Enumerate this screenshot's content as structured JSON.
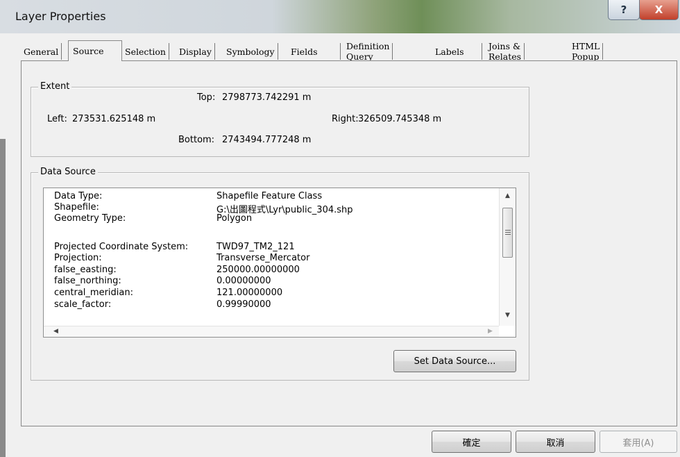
{
  "window": {
    "title": "Layer Properties",
    "help_glyph": "?",
    "close_glyph": "X"
  },
  "tabs": [
    "General",
    "Source",
    "Selection",
    "Display",
    "Symbology",
    "Fields",
    "Definition Query",
    "Labels",
    "Joins & Relates",
    "HTML Popup"
  ],
  "active_tab": "Source",
  "extent": {
    "group_label": "Extent",
    "top_label": "Top:",
    "top_value": "2798773.742291 m",
    "left_label": "Left:",
    "left_value": "273531.625148 m",
    "right_label": "Right:",
    "right_value": "326509.745348 m",
    "bottom_label": "Bottom:",
    "bottom_value": "2743494.777248 m"
  },
  "data_source": {
    "group_label": "Data Source",
    "rows": [
      {
        "key": "Data Type:",
        "value": "Shapefile Feature Class"
      },
      {
        "key": "Shapefile:",
        "value": "G:\\出圖程式\\Lyr\\public_304.shp"
      },
      {
        "key": "Geometry Type:",
        "value": "Polygon"
      },
      {
        "key": "",
        "value": ""
      },
      {
        "key": "Projected Coordinate System:",
        "value": "TWD97_TM2_121"
      },
      {
        "key": "Projection:",
        "value": "Transverse_Mercator"
      },
      {
        "key": "false_easting:",
        "value": "250000.00000000"
      },
      {
        "key": "false_northing:",
        "value": "0.00000000"
      },
      {
        "key": "central_meridian:",
        "value": "121.00000000"
      },
      {
        "key": "scale_factor:",
        "value": "0.99990000"
      }
    ],
    "set_button": "Set Data Source..."
  },
  "footer": {
    "ok": "確定",
    "cancel": "取消",
    "apply": "套用(A)"
  }
}
